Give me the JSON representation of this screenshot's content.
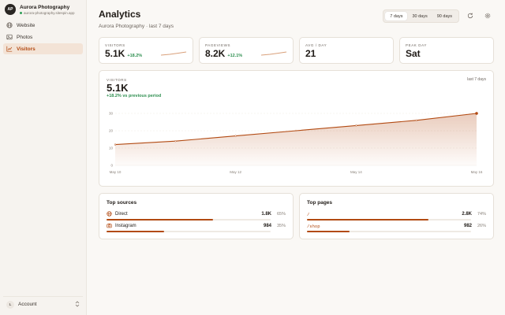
{
  "sidebar": {
    "avatar": "AP",
    "name": "Aurora Photography",
    "url": "aurora-photography.sitespin.app",
    "items": [
      {
        "label": "Website",
        "icon": "globe-icon",
        "active": false
      },
      {
        "label": "Photos",
        "icon": "image-icon",
        "active": false
      },
      {
        "label": "Visitors",
        "icon": "chart-line-icon",
        "active": true
      }
    ],
    "account": {
      "label": "Account",
      "avatar": "L"
    }
  },
  "header": {
    "title": "Analytics",
    "subtitle": "Aurora Photography · last 7 days",
    "ranges": [
      {
        "label": "7 days",
        "active": true
      },
      {
        "label": "30 days",
        "active": false
      },
      {
        "label": "90 days",
        "active": false
      }
    ]
  },
  "stats": [
    {
      "label": "VISITORS",
      "value": "5.1K",
      "delta": "+18.2%",
      "spark": true
    },
    {
      "label": "PAGEVIEWS",
      "value": "8.2K",
      "delta": "+12.1%",
      "spark": true
    },
    {
      "label": "AVG / DAY",
      "value": "21",
      "delta": "",
      "spark": false
    },
    {
      "label": "PEAK DAY",
      "value": "Sat",
      "delta": "",
      "spark": false
    }
  ],
  "visitors_chart": {
    "label": "VISITORS",
    "value": "5.1K",
    "delta": "+18.2% vs previous period",
    "range": "last 7 days"
  },
  "chart_data": {
    "type": "area",
    "x": [
      "May 10",
      "May 11",
      "May 12",
      "May 13",
      "May 14",
      "May 15",
      "May 16"
    ],
    "values": [
      12,
      14,
      17,
      20,
      23,
      26,
      30
    ],
    "y_ticks": [
      0,
      10,
      20,
      30
    ],
    "x_tick_labels": [
      "May 10",
      "May 12",
      "May 14",
      "May 16"
    ],
    "ylim": [
      0,
      30
    ],
    "color": "#b24a12",
    "grid": true
  },
  "top_sources": {
    "title": "Top sources",
    "rows": [
      {
        "label": "Direct",
        "icon": "globe-icon",
        "value": "1.8K",
        "pct": "65%",
        "fraction": 0.65
      },
      {
        "label": "Instagram",
        "icon": "camera-icon",
        "value": "984",
        "pct": "35%",
        "fraction": 0.35
      }
    ]
  },
  "top_pages": {
    "title": "Top pages",
    "rows": [
      {
        "label": "/",
        "value": "2.8K",
        "pct": "74%",
        "fraction": 0.74
      },
      {
        "label": "/shop",
        "value": "982",
        "pct": "26%",
        "fraction": 0.26
      }
    ]
  },
  "colors": {
    "accent": "#b24a12",
    "positive": "#2e8f50",
    "online": "#2e9e57"
  }
}
